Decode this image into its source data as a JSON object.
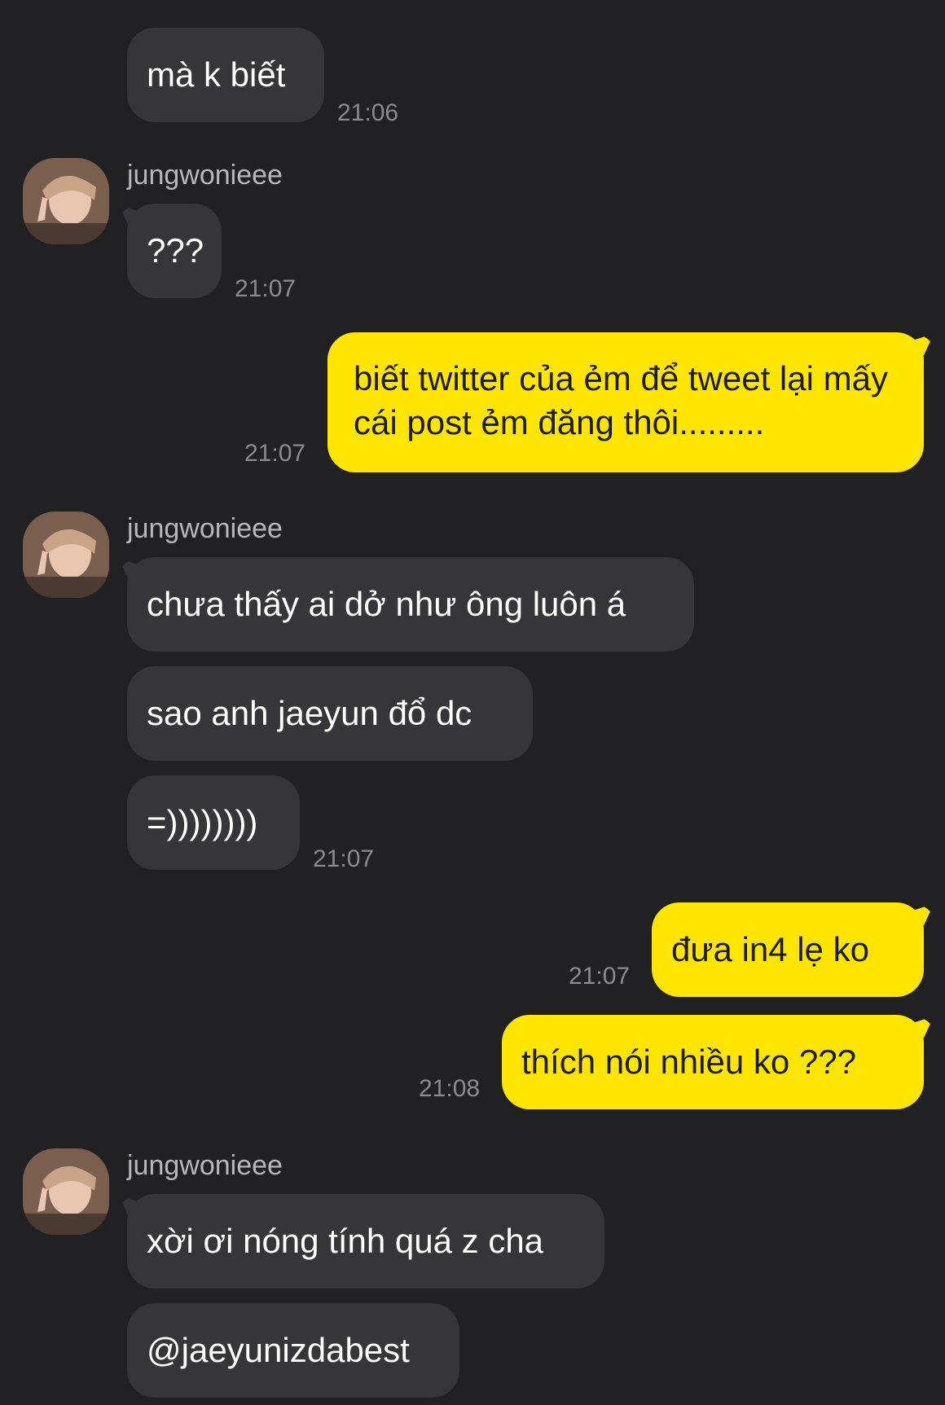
{
  "contact": {
    "name": "jungwonieee"
  },
  "messages": [
    {
      "text": "mà k biết",
      "time": "21:06"
    },
    {
      "text": "???",
      "time": "21:07"
    },
    {
      "text": "biết twitter của ẻm để tweet lại mấy cái post ẻm đăng thôi.........",
      "time": "21:07"
    },
    {
      "text": "chưa thấy ai dở như ông luôn á"
    },
    {
      "text": "sao anh jaeyun đổ dc"
    },
    {
      "text": "=))))))))",
      "time": "21:07"
    },
    {
      "text": "đưa in4 lẹ ko",
      "time": "21:07"
    },
    {
      "text": "thích nói nhiều ko ???",
      "time": "21:08"
    },
    {
      "text": "xời ơi nóng tính quá z cha"
    },
    {
      "text": "@jaeyunizdabest"
    }
  ],
  "colors": {
    "background": "#212124",
    "incoming_bubble": "#363639",
    "outgoing_bubble": "#ffe500",
    "timestamp": "#8b8b8f"
  },
  "icons": {
    "avatar": "profile-photo"
  }
}
